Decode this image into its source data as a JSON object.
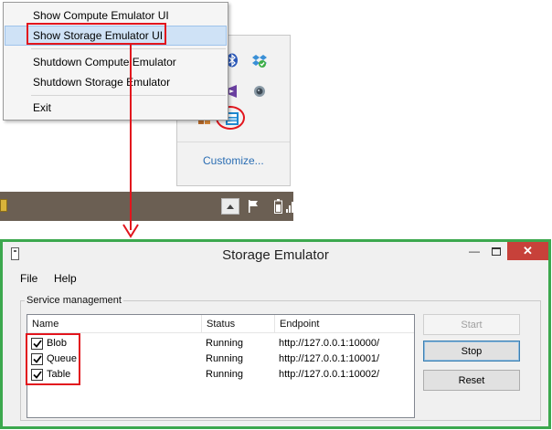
{
  "context_menu": {
    "items": [
      {
        "label": "Show Compute Emulator UI"
      },
      {
        "label": "Show Storage Emulator UI"
      },
      {
        "label": "Shutdown Compute Emulator"
      },
      {
        "label": "Shutdown Storage Emulator"
      },
      {
        "label": "Exit"
      }
    ],
    "highlighted_item": "Show Storage Emulator UI"
  },
  "tray": {
    "customize_label": "Customize...",
    "icons": [
      "bluetooth-icon",
      "dropbox-icon",
      "visual-studio-icon",
      "webcam-icon",
      "colored-squares-icon",
      "azure-emulator-icon"
    ]
  },
  "taskbar": {
    "icons": [
      "show-hidden-icons-chevron",
      "action-center-flag-icon",
      "battery-icon",
      "network-icon"
    ]
  },
  "window": {
    "title": "Storage Emulator",
    "menu": {
      "file": "File",
      "help": "Help"
    },
    "group_title": "Service management",
    "columns": {
      "name": "Name",
      "status": "Status",
      "endpoint": "Endpoint"
    },
    "services": [
      {
        "name": "Blob",
        "status": "Running",
        "endpoint": "http://127.0.0.1:10000/",
        "checked": true
      },
      {
        "name": "Queue",
        "status": "Running",
        "endpoint": "http://127.0.0.1:10001/",
        "checked": true
      },
      {
        "name": "Table",
        "status": "Running",
        "endpoint": "http://127.0.0.1:10002/",
        "checked": true
      }
    ],
    "buttons": {
      "start": "Start",
      "stop": "Stop",
      "reset": "Reset"
    }
  },
  "colors": {
    "highlight_red": "#e2151d",
    "window_border_green": "#3ca84e",
    "close_button": "#c7413a",
    "menu_hover": "#cfe2f6",
    "link_blue": "#2a6db3"
  }
}
